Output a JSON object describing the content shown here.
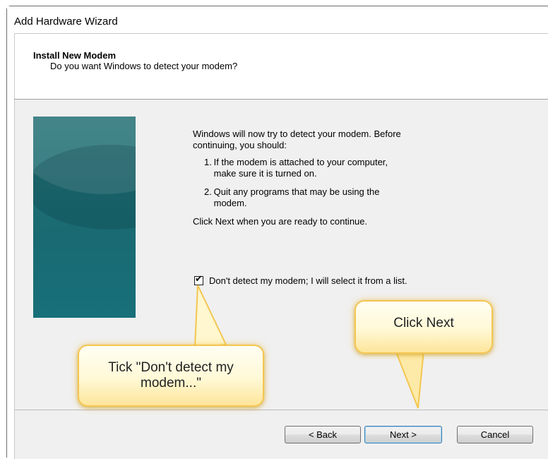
{
  "window": {
    "title": "Add Hardware Wizard"
  },
  "header": {
    "title": "Install New Modem",
    "subtitle": "Do you want Windows to detect your modem?"
  },
  "content": {
    "intro": "Windows will now try to detect your modem.  Before continuing, you should:",
    "steps": [
      {
        "num": "1.",
        "text": "If the modem is attached to your computer, make sure it is turned on."
      },
      {
        "num": "2.",
        "text": "Quit any programs that may be using the modem."
      }
    ],
    "outro": "Click Next when you are ready to continue.",
    "checkbox": {
      "label": "Don't detect my modem; I will select it from a list.",
      "checked": true,
      "mark": "✔"
    }
  },
  "buttons": {
    "back": "< Back",
    "next": "Next >",
    "cancel": "Cancel"
  },
  "callouts": {
    "tick": "Tick \"Don't detect my modem...\"",
    "next": "Click Next"
  },
  "colors": {
    "callout_border": "#f3c651",
    "banner": "#1f6d73",
    "body_bg": "#f0f0f0"
  }
}
